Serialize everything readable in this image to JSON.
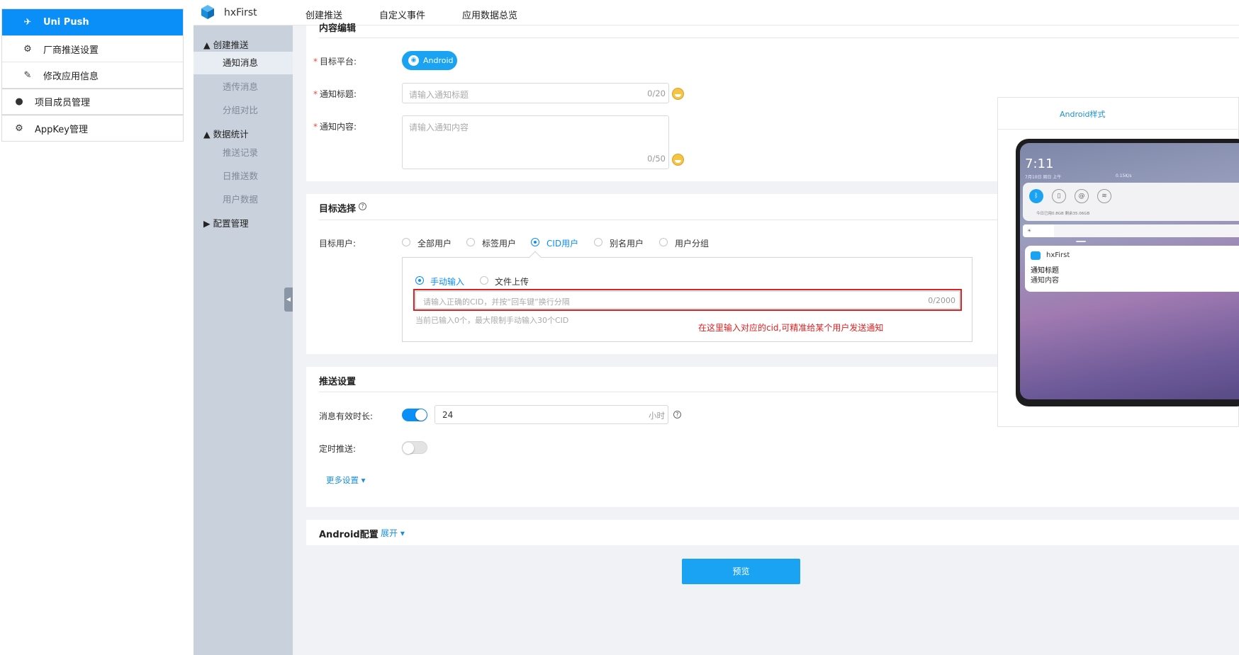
{
  "sidebar": {
    "items": [
      {
        "label": "Uni Push",
        "icon": "paper-plane-icon",
        "active": true
      },
      {
        "label": "厂商推送设置",
        "icon": "gear-icon"
      },
      {
        "label": "修改应用信息",
        "icon": "edit-icon"
      },
      {
        "label": "项目成员管理",
        "icon": "user-icon"
      },
      {
        "label": "AppKey管理",
        "icon": "gear-icon"
      }
    ]
  },
  "header": {
    "app_name": "hxFirst",
    "nav": [
      "创建推送",
      "自定义事件",
      "应用数据总览"
    ]
  },
  "subnav": {
    "groups": [
      {
        "label": "创建推送",
        "items": [
          "通知消息",
          "透传消息",
          "分组对比"
        ]
      },
      {
        "label": "数据统计",
        "items": [
          "推送记录",
          "日推送数",
          "用户数据"
        ]
      },
      {
        "label": "配置管理",
        "items": []
      }
    ],
    "active_item": "通知消息"
  },
  "content_section": {
    "title_clipped": "内容编辑",
    "platform_label": "目标平台:",
    "platform_value": "Android",
    "title_label": "通知标题:",
    "title_placeholder": "请输入通知标题",
    "title_counter": "0/20",
    "body_label": "通知内容:",
    "body_placeholder": "请输入通知内容",
    "body_counter": "0/50"
  },
  "target_section": {
    "title": "目标选择",
    "users_label": "目标用户:",
    "user_options": [
      "全部用户",
      "标签用户",
      "CID用户",
      "别名用户",
      "用户分组"
    ],
    "selected_option": "CID用户",
    "input_modes": [
      "手动输入",
      "文件上传"
    ],
    "selected_mode": "手动输入",
    "cid_placeholder": "请输入正确的CID，并按“回车键”换行分隔",
    "cid_counter": "0/2000",
    "cid_hint": "当前已输入0个，最大限制手动输入30个CID",
    "annotation": "在这里输入对应的cid,可精准给某个用户发送通知"
  },
  "push_settings": {
    "title": "推送设置",
    "ttl_label": "消息有效时长:",
    "ttl_enabled": true,
    "ttl_value": "24",
    "ttl_unit": "小时",
    "schedule_label": "定时推送:",
    "schedule_enabled": false,
    "more_label": "更多设置"
  },
  "android_config": {
    "title": "Android配置",
    "expand_label": "展开"
  },
  "preview_button": "预览",
  "preview_panel": {
    "style_label": "Android样式",
    "clock": "7:11",
    "date": "7月10日 周日 上午",
    "speed": "0.15K/s",
    "storage": "今日已用0.8GB   剩余35.06GB",
    "notif_app": "hxFirst",
    "notif_title": "通知标题",
    "notif_body": "通知内容"
  },
  "colors": {
    "accent": "#0a8ff8",
    "annotation_red": "#e02020",
    "subnav_bg": "#c9d1dc"
  }
}
